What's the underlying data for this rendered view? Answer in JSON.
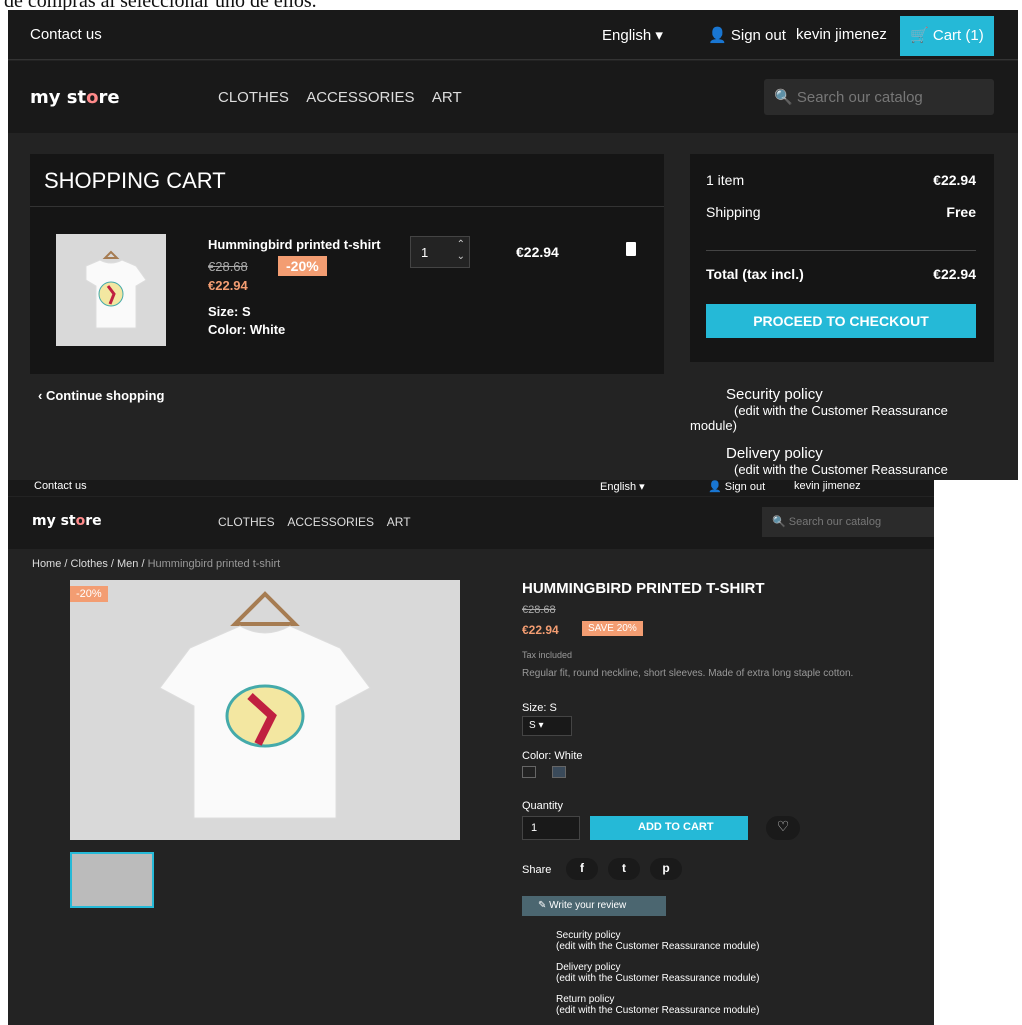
{
  "caption": "de compras al seleccionar uno de ellos.",
  "colors": {
    "accent": "#25b9d7",
    "discount": "#f39d72",
    "bg": "#232323"
  },
  "cart_page": {
    "header": {
      "contact": "Contact us",
      "language": "English ▾",
      "signout": "Sign out",
      "user": "kevin jimenez",
      "cart": "Cart (1)"
    },
    "nav": {
      "logo_my": "my st",
      "logo_o": "o",
      "logo_end": "re",
      "menu": [
        "CLOTHES",
        "ACCESSORIES",
        "ART"
      ],
      "search_placeholder": "Search our catalog"
    },
    "cart": {
      "title": "SHOPPING CART",
      "item": {
        "name": "Hummingbird printed t-shirt",
        "old_price": "€28.68",
        "discount": "-20%",
        "price": "€22.94",
        "size": "Size: S",
        "color": "Color: White",
        "quantity": "1",
        "line_total": "€22.94"
      },
      "continue": "Continue shopping"
    },
    "summary": {
      "items_label": "1 item",
      "items_value": "€22.94",
      "shipping_label": "Shipping",
      "shipping_value": "Free",
      "total_label": "Total (tax incl.)",
      "total_value": "€22.94",
      "checkout": "PROCEED TO CHECKOUT"
    },
    "reassurance": {
      "security": "Security policy",
      "security_desc": "(edit with the Customer Reassurance",
      "security_desc2": "module)",
      "delivery": "Delivery policy",
      "delivery_desc": "(edit with the Customer Reassurance"
    }
  },
  "product_page": {
    "header": {
      "contact": "Contact us",
      "language": "English ▾",
      "signout": "Sign out",
      "user": "kevin jimenez"
    },
    "nav": {
      "menu": [
        "CLOTHES",
        "ACCESSORIES",
        "ART"
      ],
      "search_placeholder": "Search our catalog"
    },
    "breadcrumb": {
      "home": "Home",
      "clothes": "Clothes",
      "men": "Men",
      "current": "Hummingbird printed t-shirt"
    },
    "image_discount": "-20%",
    "title": "HUMMINGBIRD PRINTED T-SHIRT",
    "old_price": "€28.68",
    "price": "€22.94",
    "save": "SAVE 20%",
    "tax": "Tax included",
    "description": "Regular fit, round neckline, short sleeves. Made of extra long staple cotton.",
    "size_label": "Size: S",
    "size_value": "S",
    "color_label": "Color: White",
    "quantity_label": "Quantity",
    "quantity_value": "1",
    "add_to_cart": "ADD TO CART",
    "share_label": "Share",
    "write_review": "Write your review",
    "reassurance": [
      {
        "title": "Security policy",
        "desc": "(edit with the Customer Reassurance module)"
      },
      {
        "title": "Delivery policy",
        "desc": "(edit with the Customer Reassurance module)"
      },
      {
        "title": "Return policy",
        "desc": "(edit with the Customer Reassurance module)"
      }
    ]
  }
}
